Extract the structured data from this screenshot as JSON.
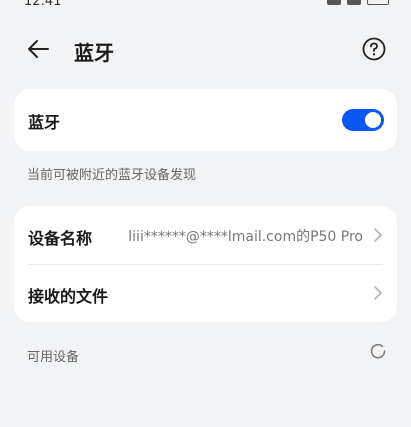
{
  "status_bar": {
    "time": "12:41"
  },
  "header": {
    "title": "蓝牙",
    "back_icon": "arrow-left-icon",
    "help_icon": "question-circle-icon"
  },
  "bluetooth": {
    "label": "蓝牙",
    "enabled": true,
    "visibility_hint": "当前可被附近的蓝牙设备发现"
  },
  "device_settings": {
    "device_name_label": "设备名称",
    "device_name_value": "liii******@****lmail.com的P50 Pro",
    "received_files_label": "接收的文件"
  },
  "available_devices": {
    "label": "可用设备"
  },
  "colors": {
    "accent": "#0a59f7",
    "background": "#f1f3f5",
    "card": "#ffffff"
  }
}
